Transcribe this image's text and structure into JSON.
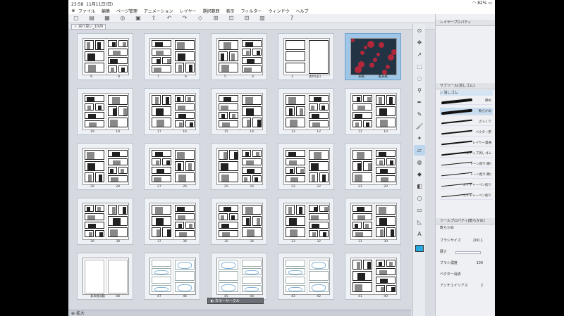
{
  "status": {
    "time": "23:58",
    "date": "11月11日(日)",
    "battery": "82%"
  },
  "menu": [
    "ファイル",
    "編集",
    "ページ管理",
    "アニメーション",
    "レイヤー",
    "選択範囲",
    "表示",
    "フィルター",
    "ウィンドウ",
    "ヘルプ"
  ],
  "tab": {
    "label": "宗介思い_1026"
  },
  "pages": [
    {
      "left": "9",
      "right": "8",
      "kind": "ink"
    },
    {
      "left": "7",
      "right": "6",
      "kind": "ink"
    },
    {
      "left": "5",
      "right": "4",
      "kind": "ink"
    },
    {
      "left": "3",
      "right": "奥付(前)",
      "kind": "title"
    },
    {
      "left": "表紙",
      "right": "裏表紙",
      "kind": "cover"
    },
    {
      "left": "19",
      "right": "18",
      "kind": "ink"
    },
    {
      "left": "17",
      "right": "16",
      "kind": "ink"
    },
    {
      "left": "15",
      "right": "14",
      "kind": "ink"
    },
    {
      "left": "13",
      "right": "12",
      "kind": "ink"
    },
    {
      "left": "11",
      "right": "10",
      "kind": "ink"
    },
    {
      "left": "29",
      "right": "28",
      "kind": "ink"
    },
    {
      "left": "27",
      "right": "26",
      "kind": "ink"
    },
    {
      "left": "25",
      "right": "24",
      "kind": "ink"
    },
    {
      "left": "23",
      "right": "22",
      "kind": "ink"
    },
    {
      "left": "21",
      "right": "20",
      "kind": "ink"
    },
    {
      "left": "39",
      "right": "38",
      "kind": "ink"
    },
    {
      "left": "37",
      "right": "36",
      "kind": "ink"
    },
    {
      "left": "35",
      "right": "34",
      "kind": "ink"
    },
    {
      "left": "33",
      "right": "32",
      "kind": "ink"
    },
    {
      "left": "31",
      "right": "30",
      "kind": "ink"
    },
    {
      "left": "表表紙(裏)",
      "right": "48",
      "kind": "blank"
    },
    {
      "left": "47",
      "right": "46",
      "kind": "sketch"
    },
    {
      "left": "45",
      "right": "44",
      "kind": "sketch"
    },
    {
      "left": "43",
      "right": "42",
      "kind": "sketch"
    },
    {
      "left": "41",
      "right": "40",
      "kind": "ink"
    }
  ],
  "floatbar": {
    "label": "カラーサークル"
  },
  "layer_panel": {
    "title": "レイヤープロパティ"
  },
  "subtool_panel": {
    "title": "サブツール[消しゴム]",
    "group": "消しゴム"
  },
  "brushes": [
    "硬め",
    "軟らかめ",
    "ざっくり",
    "ベクター用",
    "レイヤー貫通",
    "スナップ消しゴム",
    "トーン削り(硬)",
    "トーン削り(軟)",
    "ネイチャーペン削り",
    "エイチャーペン削り"
  ],
  "tool_props": {
    "title": "ツールプロパティ[軟らかめ]",
    "current": "軟らかめ",
    "brush_size_label": "ブラシサイズ",
    "brush_size": "200.1",
    "hardness_label": "硬さ",
    "density_label": "ブラシ濃度",
    "density": "100",
    "vector_label": "ベクター消去",
    "aa_label": "アンチエイリアス",
    "aa_value": "2"
  },
  "zoom": "拡大",
  "colors": {
    "accent": "#29a8e0",
    "selection": "#9fc6e6"
  }
}
